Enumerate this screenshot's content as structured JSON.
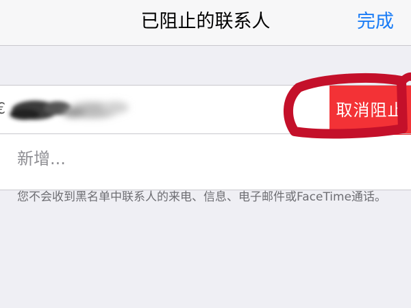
{
  "navbar": {
    "title": "已阻止的联系人",
    "done_label": "完成"
  },
  "contact": {
    "name_visible": "€",
    "unblock_label": "取消阻止"
  },
  "add_row": {
    "label": "新增..."
  },
  "footer": {
    "note": "您不会收到黑名单中联系人的来电、信息、电子邮件或FaceTime通话。"
  },
  "colors": {
    "accent": "#1a7cf6",
    "destructive": "#f33236",
    "annotation": "#c4102a",
    "background": "#efeff4"
  }
}
